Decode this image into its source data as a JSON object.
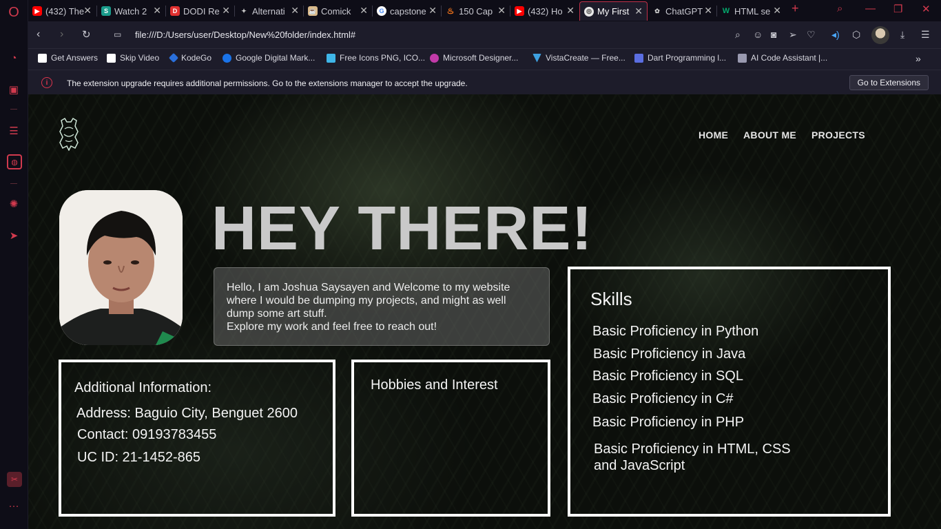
{
  "browser": {
    "tabs": [
      {
        "label": "(432) The",
        "favicon": "youtube-icon",
        "color": "#ff0000"
      },
      {
        "label": "Watch 2",
        "favicon": "s-icon",
        "color": "#1a9c8c"
      },
      {
        "label": "DODI Re",
        "favicon": "d-icon",
        "color": "#e03030"
      },
      {
        "label": "Alternati",
        "favicon": "alternative-icon",
        "color": "#cccccc"
      },
      {
        "label": "Comick",
        "favicon": "comick-icon",
        "color": "#d9b98a"
      },
      {
        "label": "capstone",
        "favicon": "google-icon",
        "color": "#4285f4"
      },
      {
        "label": "150 Cap",
        "favicon": "fire-icon",
        "color": "#ff7a1a"
      },
      {
        "label": "(432) Ho",
        "favicon": "youtube-icon",
        "color": "#ff0000"
      },
      {
        "label": "My First",
        "favicon": "globe-icon",
        "color": "#e8e8e8"
      },
      {
        "label": "ChatGPT",
        "favicon": "chatgpt-icon",
        "color": "#cfcfcf"
      },
      {
        "label": "HTML se",
        "favicon": "w3schools-icon",
        "color": "#04aa6d"
      }
    ],
    "url": "file:///D:/Users/user/Desktop/New%20folder/index.html#",
    "bookmarks": [
      {
        "label": "Get Answers",
        "color": "#ffffff"
      },
      {
        "label": "Skip Video",
        "color": "#ffffff"
      },
      {
        "label": "KodeGo",
        "color": "#2a6fdb"
      },
      {
        "label": "Google Digital Mark...",
        "color": "#1a73e8"
      },
      {
        "label": "Free Icons PNG, ICO...",
        "color": "#3fb6e8"
      },
      {
        "label": "Microsoft Designer...",
        "color": "#c23aa8"
      },
      {
        "label": "VistaCreate — Free...",
        "color": "#3ea0e0"
      },
      {
        "label": "Dart Programming l...",
        "color": "#5b6ee1"
      },
      {
        "label": "AI Code Assistant |...",
        "color": "#9a9ab0"
      }
    ],
    "notification": {
      "text": "The extension upgrade requires additional permissions. Go to the extensions manager to accept the upgrade.",
      "button": "Go to Extensions"
    }
  },
  "page": {
    "nav": [
      "HOME",
      "ABOUT ME",
      "PROJECTS"
    ],
    "hero_title": "HEY THERE!",
    "intro": [
      "Hello, I am Joshua Saysayen and Welcome to my website",
      "where I would be dumping my projects, and might as well",
      "dump some art stuff.",
      "Explore my work and feel free to reach out!"
    ],
    "additional": {
      "title": "Additional Information:",
      "address": "Address: Baguio City, Benguet 2600",
      "contact": "Contact: 09193783455",
      "ucid": "UC ID: 21-1452-865"
    },
    "hobbies": {
      "title": "Hobbies and Interest"
    },
    "skills": {
      "title": "Skills",
      "items": [
        "Basic Proficiency in Python",
        "Basic Proficiency in Java",
        "Basic Proficiency in SQL",
        "Basic Proficiency in C#",
        "Basic Proficiency in PHP"
      ],
      "last_line1": "Basic Proficiency in HTML, CSS",
      "last_line2": "and JavaScript"
    }
  },
  "colors": {
    "opera_red": "#d23a4e",
    "box_border": "#ffffff",
    "hero_text": "#c9c9c9"
  }
}
